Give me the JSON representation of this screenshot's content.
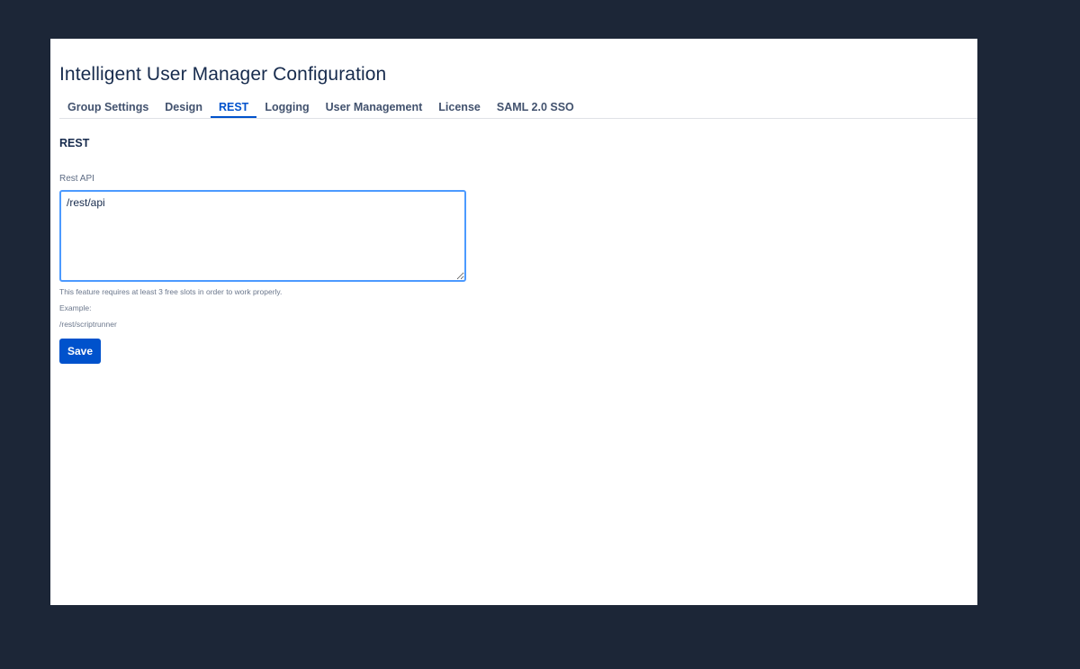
{
  "page": {
    "title": "Intelligent User Manager Configuration"
  },
  "tabs": [
    {
      "label": "Group Settings",
      "active": false
    },
    {
      "label": "Design",
      "active": false
    },
    {
      "label": "REST",
      "active": true
    },
    {
      "label": "Logging",
      "active": false
    },
    {
      "label": "User Management",
      "active": false
    },
    {
      "label": "License",
      "active": false
    },
    {
      "label": "SAML 2.0 SSO",
      "active": false
    }
  ],
  "section": {
    "heading": "REST"
  },
  "rest_api": {
    "label": "Rest API",
    "value": "/rest/api"
  },
  "help": {
    "requirement": "This feature requires at least 3 free slots in order to work properly.",
    "example_label": "Example:",
    "example_value": "/rest/scriptrunner"
  },
  "actions": {
    "save_label": "Save"
  },
  "colors": {
    "background": "#1c2637",
    "panel": "#ffffff",
    "accent": "#0052cc",
    "focus_border": "#4c9aff"
  }
}
